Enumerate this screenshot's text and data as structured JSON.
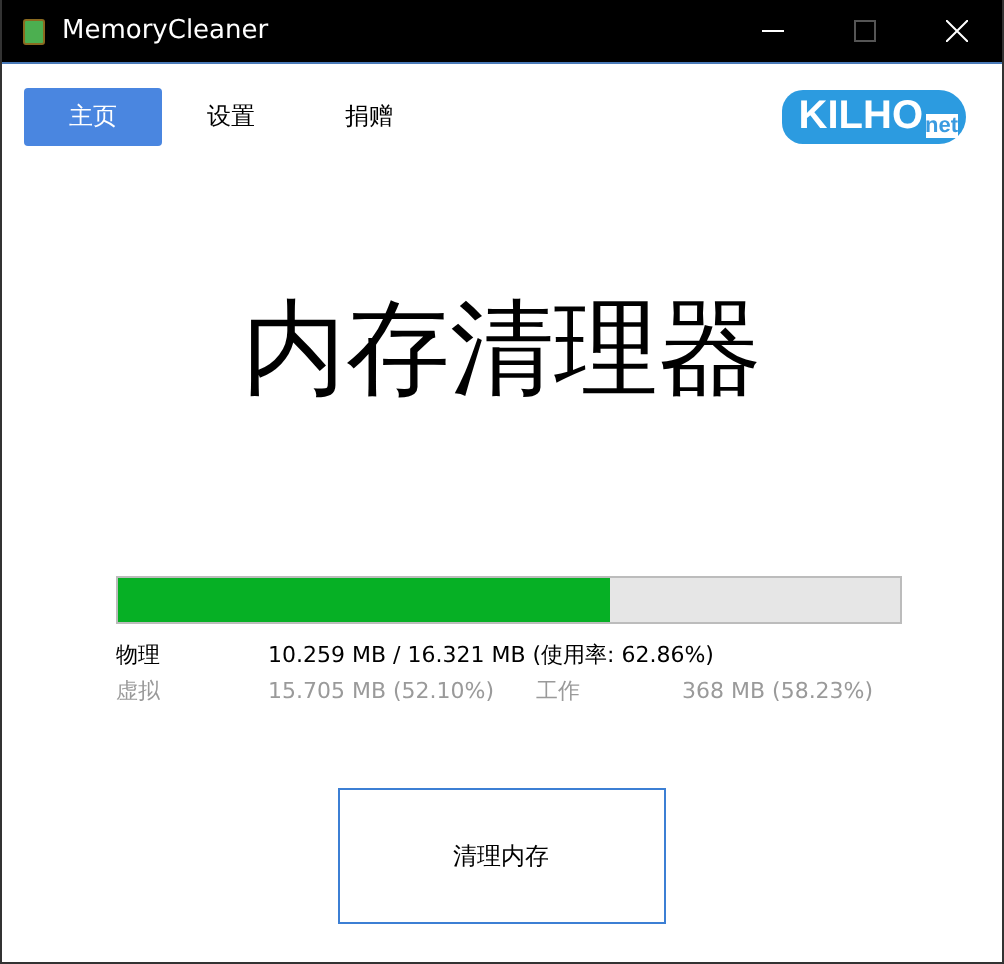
{
  "window": {
    "title": "MemoryCleaner"
  },
  "tabs": [
    {
      "label": "主页",
      "selected": true
    },
    {
      "label": "设置",
      "selected": false
    },
    {
      "label": "捐赠",
      "selected": false
    }
  ],
  "logo": {
    "main": "KILHO",
    "suffix": "net"
  },
  "heading": "内存清理器",
  "memory_bar": {
    "level": 0.6286
  },
  "stats": [
    {
      "disabled": false,
      "cells": [
        "物理",
        "10.259 MB / 16.321 MB (使用率: 62.86%)"
      ]
    },
    {
      "disabled": true,
      "cells": [
        "虚拟",
        "15.705 MB (52.10%)",
        "工作",
        "368 MB (58.23%)"
      ]
    }
  ],
  "button": "清理内存"
}
